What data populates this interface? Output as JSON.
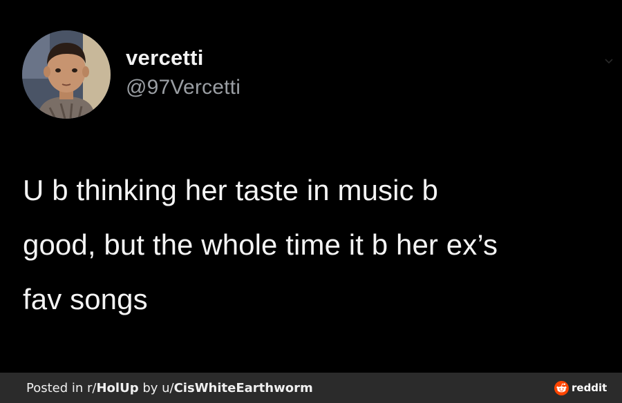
{
  "tweet": {
    "display_name": "vercetti",
    "handle": "@97Vercetti",
    "text_lines": [
      "U b thinking her taste in music b",
      "good, but the whole time it b her ex’s",
      "fav songs"
    ],
    "avatar_icon": "profile-photo",
    "menu_icon": "chevron-down-icon"
  },
  "footer": {
    "posted_in_label": "Posted in r/",
    "subreddit": "HolUp",
    "by_label": " by u/",
    "username": "CisWhiteEarthworm",
    "brand": "reddit",
    "brand_icon": "reddit-logo-icon",
    "brand_color": "#ff4500"
  },
  "colors": {
    "background": "#000000",
    "text": "#f4f4f4",
    "handle": "#9a9ea3",
    "footer_bg": "#2b2b2b"
  }
}
